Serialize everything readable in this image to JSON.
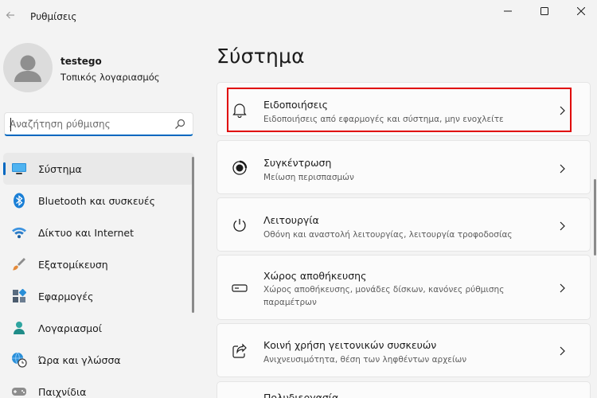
{
  "app": {
    "title": "Ρυθμίσεις"
  },
  "profile": {
    "name": "testego",
    "account_type": "Τοπικός λογαριασμός"
  },
  "search": {
    "placeholder": "Αναζήτηση ρύθμισης"
  },
  "sidebar": {
    "items": [
      {
        "label": "Σύστημα",
        "icon": "monitor-icon",
        "active": true
      },
      {
        "label": "Bluetooth και συσκευές",
        "icon": "bluetooth-icon"
      },
      {
        "label": "Δίκτυο και Internet",
        "icon": "wifi-icon"
      },
      {
        "label": "Εξατομίκευση",
        "icon": "brush-icon"
      },
      {
        "label": "Εφαρμογές",
        "icon": "apps-icon"
      },
      {
        "label": "Λογαριασμοί",
        "icon": "person-icon"
      },
      {
        "label": "Ώρα και γλώσσα",
        "icon": "globe-clock-icon"
      },
      {
        "label": "Παιχνίδια",
        "icon": "gamepad-icon"
      }
    ]
  },
  "main": {
    "title": "Σύστημα",
    "cards": [
      {
        "title": "Ειδοποιήσεις",
        "subtitle": "Ειδοποιήσεις από εφαρμογές και σύστημα, μην ενοχλείτε",
        "icon": "bell-icon",
        "highlighted": true
      },
      {
        "title": "Συγκέντρωση",
        "subtitle": "Μείωση περισπασμών",
        "icon": "focus-icon"
      },
      {
        "title": "Λειτουργία",
        "subtitle": "Οθόνη και αναστολή λειτουργίας, λειτουργία τροφοδοσίας",
        "icon": "power-icon"
      },
      {
        "title": "Χώρος αποθήκευσης",
        "subtitle": "Χώρος αποθήκευσης, μονάδες δίσκων, κανόνες ρύθμισης παραμέτρων",
        "icon": "storage-icon"
      },
      {
        "title": "Κοινή χρήση γειτονικών συσκευών",
        "subtitle": "Ανιχνευσιμότητα, θέση των ληφθέντων αρχείων",
        "icon": "share-icon"
      },
      {
        "title": "Πολυδιεργασία",
        "icon": "multitasking-icon"
      }
    ]
  },
  "colors": {
    "accent": "#0067c0",
    "highlight_border": "#e00000",
    "background": "#f3f3f3"
  }
}
